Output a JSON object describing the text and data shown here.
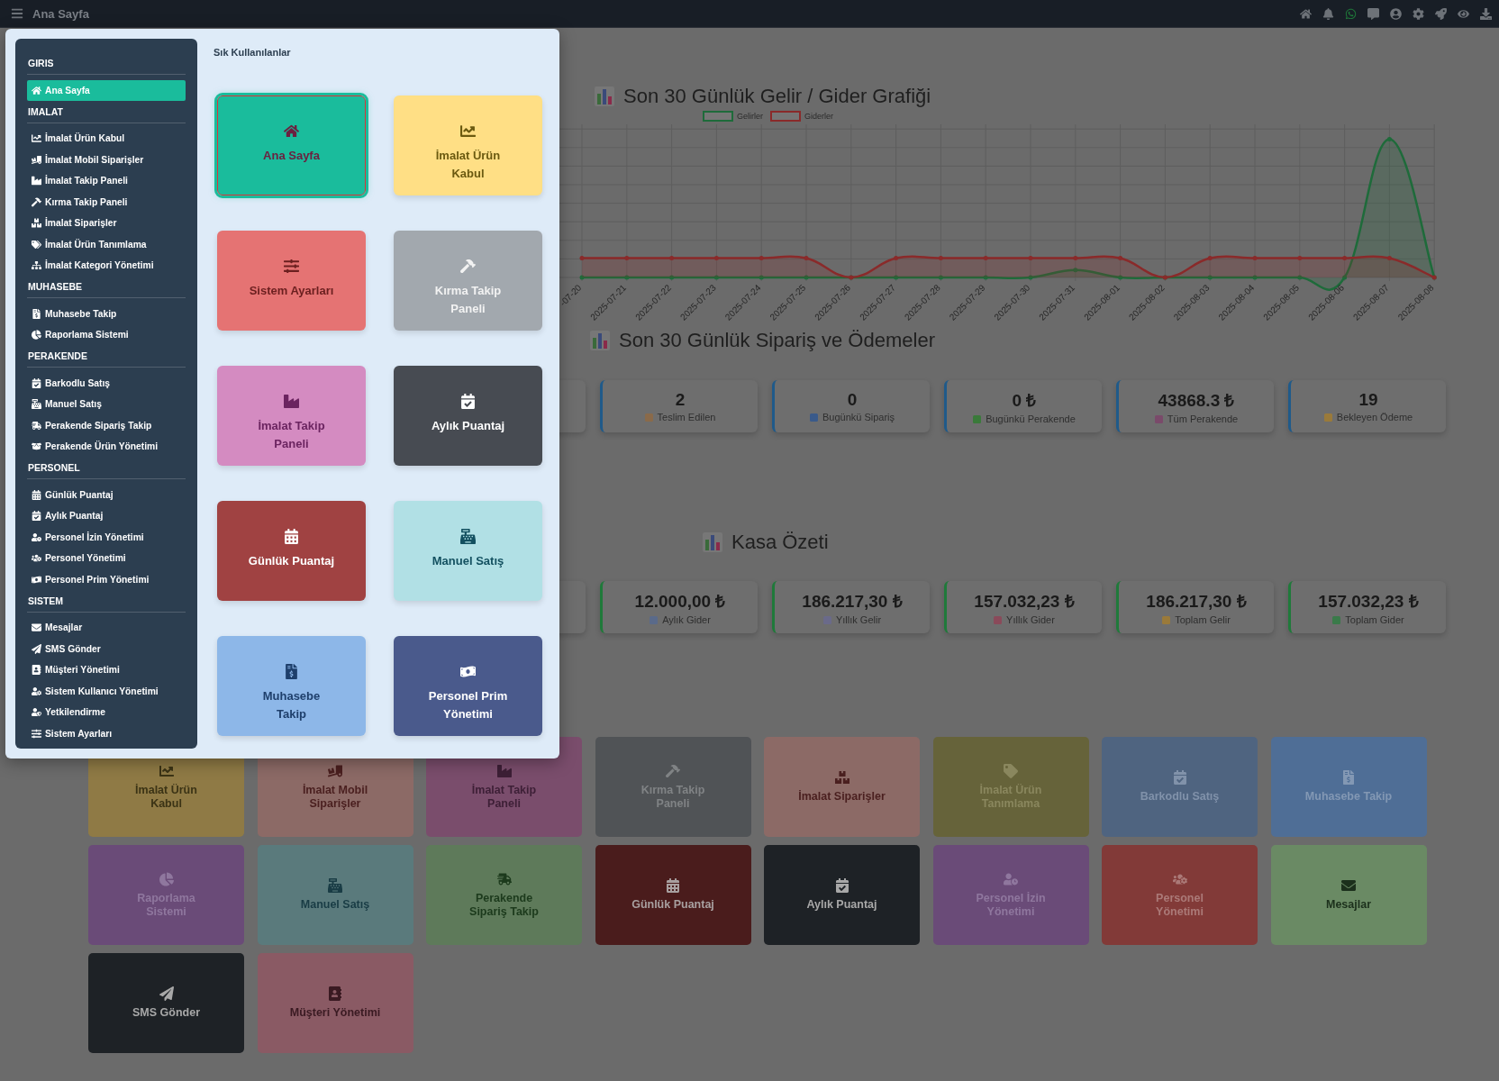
{
  "topbar": {
    "title": "Ana Sayfa"
  },
  "chart": {
    "title": "Son 30 Günlük Gelir / Gider Grafiği",
    "legend": [
      {
        "label": "Gelirler",
        "color": "#1e6b3a"
      },
      {
        "label": "Giderler",
        "color": "#8a2a2a"
      }
    ],
    "x_labels": [
      "-07-20",
      "2025-07-21",
      "2025-07-22",
      "2025-07-23",
      "2025-07-24",
      "2025-07-25",
      "2025-07-26",
      "2025-07-27",
      "2025-07-28",
      "2025-07-29",
      "2025-07-30",
      "2025-07-31",
      "2025-08-01",
      "2025-08-02",
      "2025-08-03",
      "2025-08-04",
      "2025-08-05",
      "2025-08-06",
      "2025-08-07",
      "2025-08-08"
    ]
  },
  "orders": {
    "title": "Son 30 Günlük Sipariş ve Ödemeler",
    "stats": [
      {
        "value": "2",
        "label": "Teslim Edilen"
      },
      {
        "value": "0",
        "label": "Bugünkü Sipariş"
      },
      {
        "value": "0 ₺",
        "label": "Bugünkü Perakende"
      },
      {
        "value": "43868.3 ₺",
        "label": "Tüm Perakende"
      },
      {
        "value": "19",
        "label": "Bekleyen Ödeme"
      }
    ]
  },
  "cash": {
    "title": "Kasa Özeti",
    "stats": [
      {
        "value": "12.000,00 ₺",
        "label": "Aylık Gider"
      },
      {
        "value": "186.217,30 ₺",
        "label": "Yıllık Gelir"
      },
      {
        "value": "157.032,23 ₺",
        "label": "Yıllık Gider"
      },
      {
        "value": "186.217,30 ₺",
        "label": "Toplam Gelir"
      },
      {
        "value": "157.032,23 ₺",
        "label": "Toplam Gider"
      }
    ]
  },
  "tiles": [
    {
      "label": "İmalat Ürün Kabul",
      "color": "#8f7a45"
    },
    {
      "label": "İmalat Mobil Siparişler",
      "color": "#8c6a66"
    },
    {
      "label": "İmalat Takip Paneli",
      "color": "#7a4d6c"
    },
    {
      "label": "Kırma Takip Paneli",
      "color": "#505356"
    },
    {
      "label": "İmalat Siparişler",
      "color": "#8c6a66"
    },
    {
      "label": "İmalat Ürün Tanımlama",
      "color": "#66633a"
    },
    {
      "label": "Barkodlu Satış",
      "color": "#4f6480"
    },
    {
      "label": "Muhasebe Takip",
      "color": "#4f6e96"
    },
    {
      "label": "Raporlama Sistemi",
      "color": "#6a4b78"
    },
    {
      "label": "Manuel Satış",
      "color": "#5a7a7c"
    },
    {
      "label": "Perakende Sipariş Takip",
      "color": "#5e7a5a"
    },
    {
      "label": "Günlük Puantaj",
      "color": "#4a1c1c"
    },
    {
      "label": "Aylık Puantaj",
      "color": "#1e2226"
    },
    {
      "label": "Personel İzin Yönetimi",
      "color": "#6a4b78"
    },
    {
      "label": "Personel Yönetimi",
      "color": "#823a38"
    },
    {
      "label": "Mesajlar",
      "color": "#6a8a64"
    },
    {
      "label": "SMS Gönder",
      "color": "#1e2226"
    },
    {
      "label": "Müşteri Yönetimi",
      "color": "#8a5a64"
    }
  ],
  "modal": {
    "sidebar": [
      {
        "title": "GIRIS",
        "items": [
          {
            "label": "Ana Sayfa",
            "selected": true
          }
        ]
      },
      {
        "title": "IMALAT",
        "items": [
          {
            "label": "İmalat Ürün Kabul",
            "selected": false
          },
          {
            "label": "İmalat Mobil Siparişler",
            "selected": false
          },
          {
            "label": "İmalat Takip Paneli",
            "selected": false
          },
          {
            "label": "Kırma Takip Paneli",
            "selected": false
          },
          {
            "label": "İmalat Siparişler",
            "selected": false
          },
          {
            "label": "İmalat Ürün Tanımlama",
            "selected": false
          },
          {
            "label": "İmalat Kategori Yönetimi",
            "selected": false
          }
        ]
      },
      {
        "title": "MUHASEBE",
        "items": [
          {
            "label": "Muhasebe Takip",
            "selected": false
          },
          {
            "label": "Raporlama Sistemi",
            "selected": false
          }
        ]
      },
      {
        "title": "PERAKENDE",
        "items": [
          {
            "label": "Barkodlu Satış",
            "selected": false
          },
          {
            "label": "Manuel Satış",
            "selected": false
          },
          {
            "label": "Perakende Sipariş Takip",
            "selected": false
          },
          {
            "label": "Perakende Ürün Yönetimi",
            "selected": false
          }
        ]
      },
      {
        "title": "PERSONEL",
        "items": [
          {
            "label": "Günlük Puantaj",
            "selected": false
          },
          {
            "label": "Aylık Puantaj",
            "selected": false
          },
          {
            "label": "Personel İzin Yönetimi",
            "selected": false
          },
          {
            "label": "Personel Yönetimi",
            "selected": false
          },
          {
            "label": "Personel Prim Yönetimi",
            "selected": false
          }
        ]
      },
      {
        "title": "SISTEM",
        "items": [
          {
            "label": "Mesajlar",
            "selected": false
          },
          {
            "label": "SMS Gönder",
            "selected": false
          },
          {
            "label": "Müşteri Yönetimi",
            "selected": false
          },
          {
            "label": "Sistem Kullanıcı Yönetimi",
            "selected": false
          },
          {
            "label": "Yetkilendirme",
            "selected": false
          },
          {
            "label": "Sistem Ayarları",
            "selected": false
          }
        ]
      }
    ],
    "favorites": {
      "title": "Sık Kullanılanlar",
      "items": [
        {
          "label": "Ana Sayfa",
          "color": "#1abc9c",
          "selected": true
        },
        {
          "label": "İmalat Ürün Kabul",
          "color": "#ffdf85",
          "selected": false
        },
        {
          "label": "Sistem Ayarları",
          "color": "#e57373",
          "selected": false
        },
        {
          "label": "Kırma Takip Paneli",
          "color": "#a2a8ae",
          "selected": false
        },
        {
          "label": "İmalat Takip Paneli",
          "color": "#d48bc1",
          "selected": false
        },
        {
          "label": "Aylık Puantaj",
          "color": "#474b52",
          "selected": false
        },
        {
          "label": "Günlük Puantaj",
          "color": "#a04242",
          "selected": false
        },
        {
          "label": "Manuel Satış",
          "color": "#b1e0e5",
          "selected": false
        },
        {
          "label": "Muhasebe Takip",
          "color": "#8db7e8",
          "selected": false
        },
        {
          "label": "Personel Prim Yönetimi",
          "color": "#4a5a8c",
          "selected": false
        }
      ]
    }
  }
}
